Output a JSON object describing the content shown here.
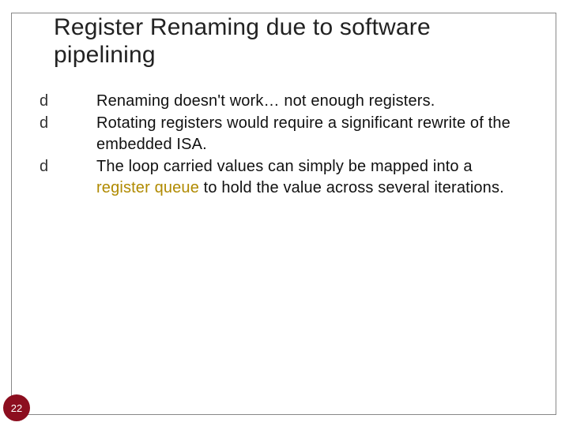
{
  "slide": {
    "title": "Register Renaming due to software pipelining",
    "bullets": [
      {
        "glyph": "d",
        "pre": "Renaming doesn't work… not enough registers."
      },
      {
        "glyph": "d",
        "pre": "Rotating registers",
        "accent": "",
        "post": " would require a significant rewrite of the embedded ISA."
      },
      {
        "glyph": "d",
        "pre": "The loop carried values can simply be mapped into a ",
        "accent": "register queue",
        "post": " to hold the value across several iterations."
      }
    ],
    "page_number": "22"
  }
}
